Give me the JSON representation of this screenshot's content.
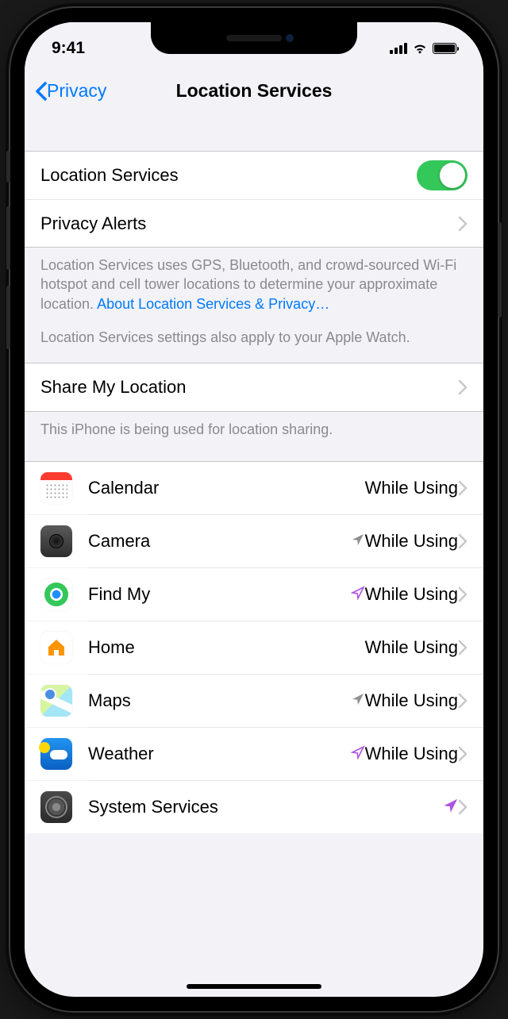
{
  "status": {
    "time": "9:41"
  },
  "nav": {
    "back": "Privacy",
    "title": "Location Services"
  },
  "rows": {
    "location_services": "Location Services",
    "privacy_alerts": "Privacy Alerts",
    "share_my_location": "Share My Location"
  },
  "footers": {
    "ls_desc_1": "Location Services uses GPS, Bluetooth, and crowd-sourced Wi-Fi hotspot and cell tower locations to determine your approximate location. ",
    "ls_link": "About Location Services & Privacy…",
    "ls_desc_2": "Location Services settings also apply to your Apple Watch.",
    "share_desc": "This iPhone is being used for location sharing."
  },
  "apps": [
    {
      "icon": "calendar",
      "name": "Calendar",
      "status": "While Using",
      "arrow": "none"
    },
    {
      "icon": "camera",
      "name": "Camera",
      "status": "While Using",
      "arrow": "gray"
    },
    {
      "icon": "findmy",
      "name": "Find My",
      "status": "While Using",
      "arrow": "purple-outline"
    },
    {
      "icon": "home",
      "name": "Home",
      "status": "While Using",
      "arrow": "none"
    },
    {
      "icon": "maps",
      "name": "Maps",
      "status": "While Using",
      "arrow": "gray"
    },
    {
      "icon": "weather",
      "name": "Weather",
      "status": "While Using",
      "arrow": "purple-outline"
    },
    {
      "icon": "system",
      "name": "System Services",
      "status": "",
      "arrow": "purple"
    }
  ]
}
